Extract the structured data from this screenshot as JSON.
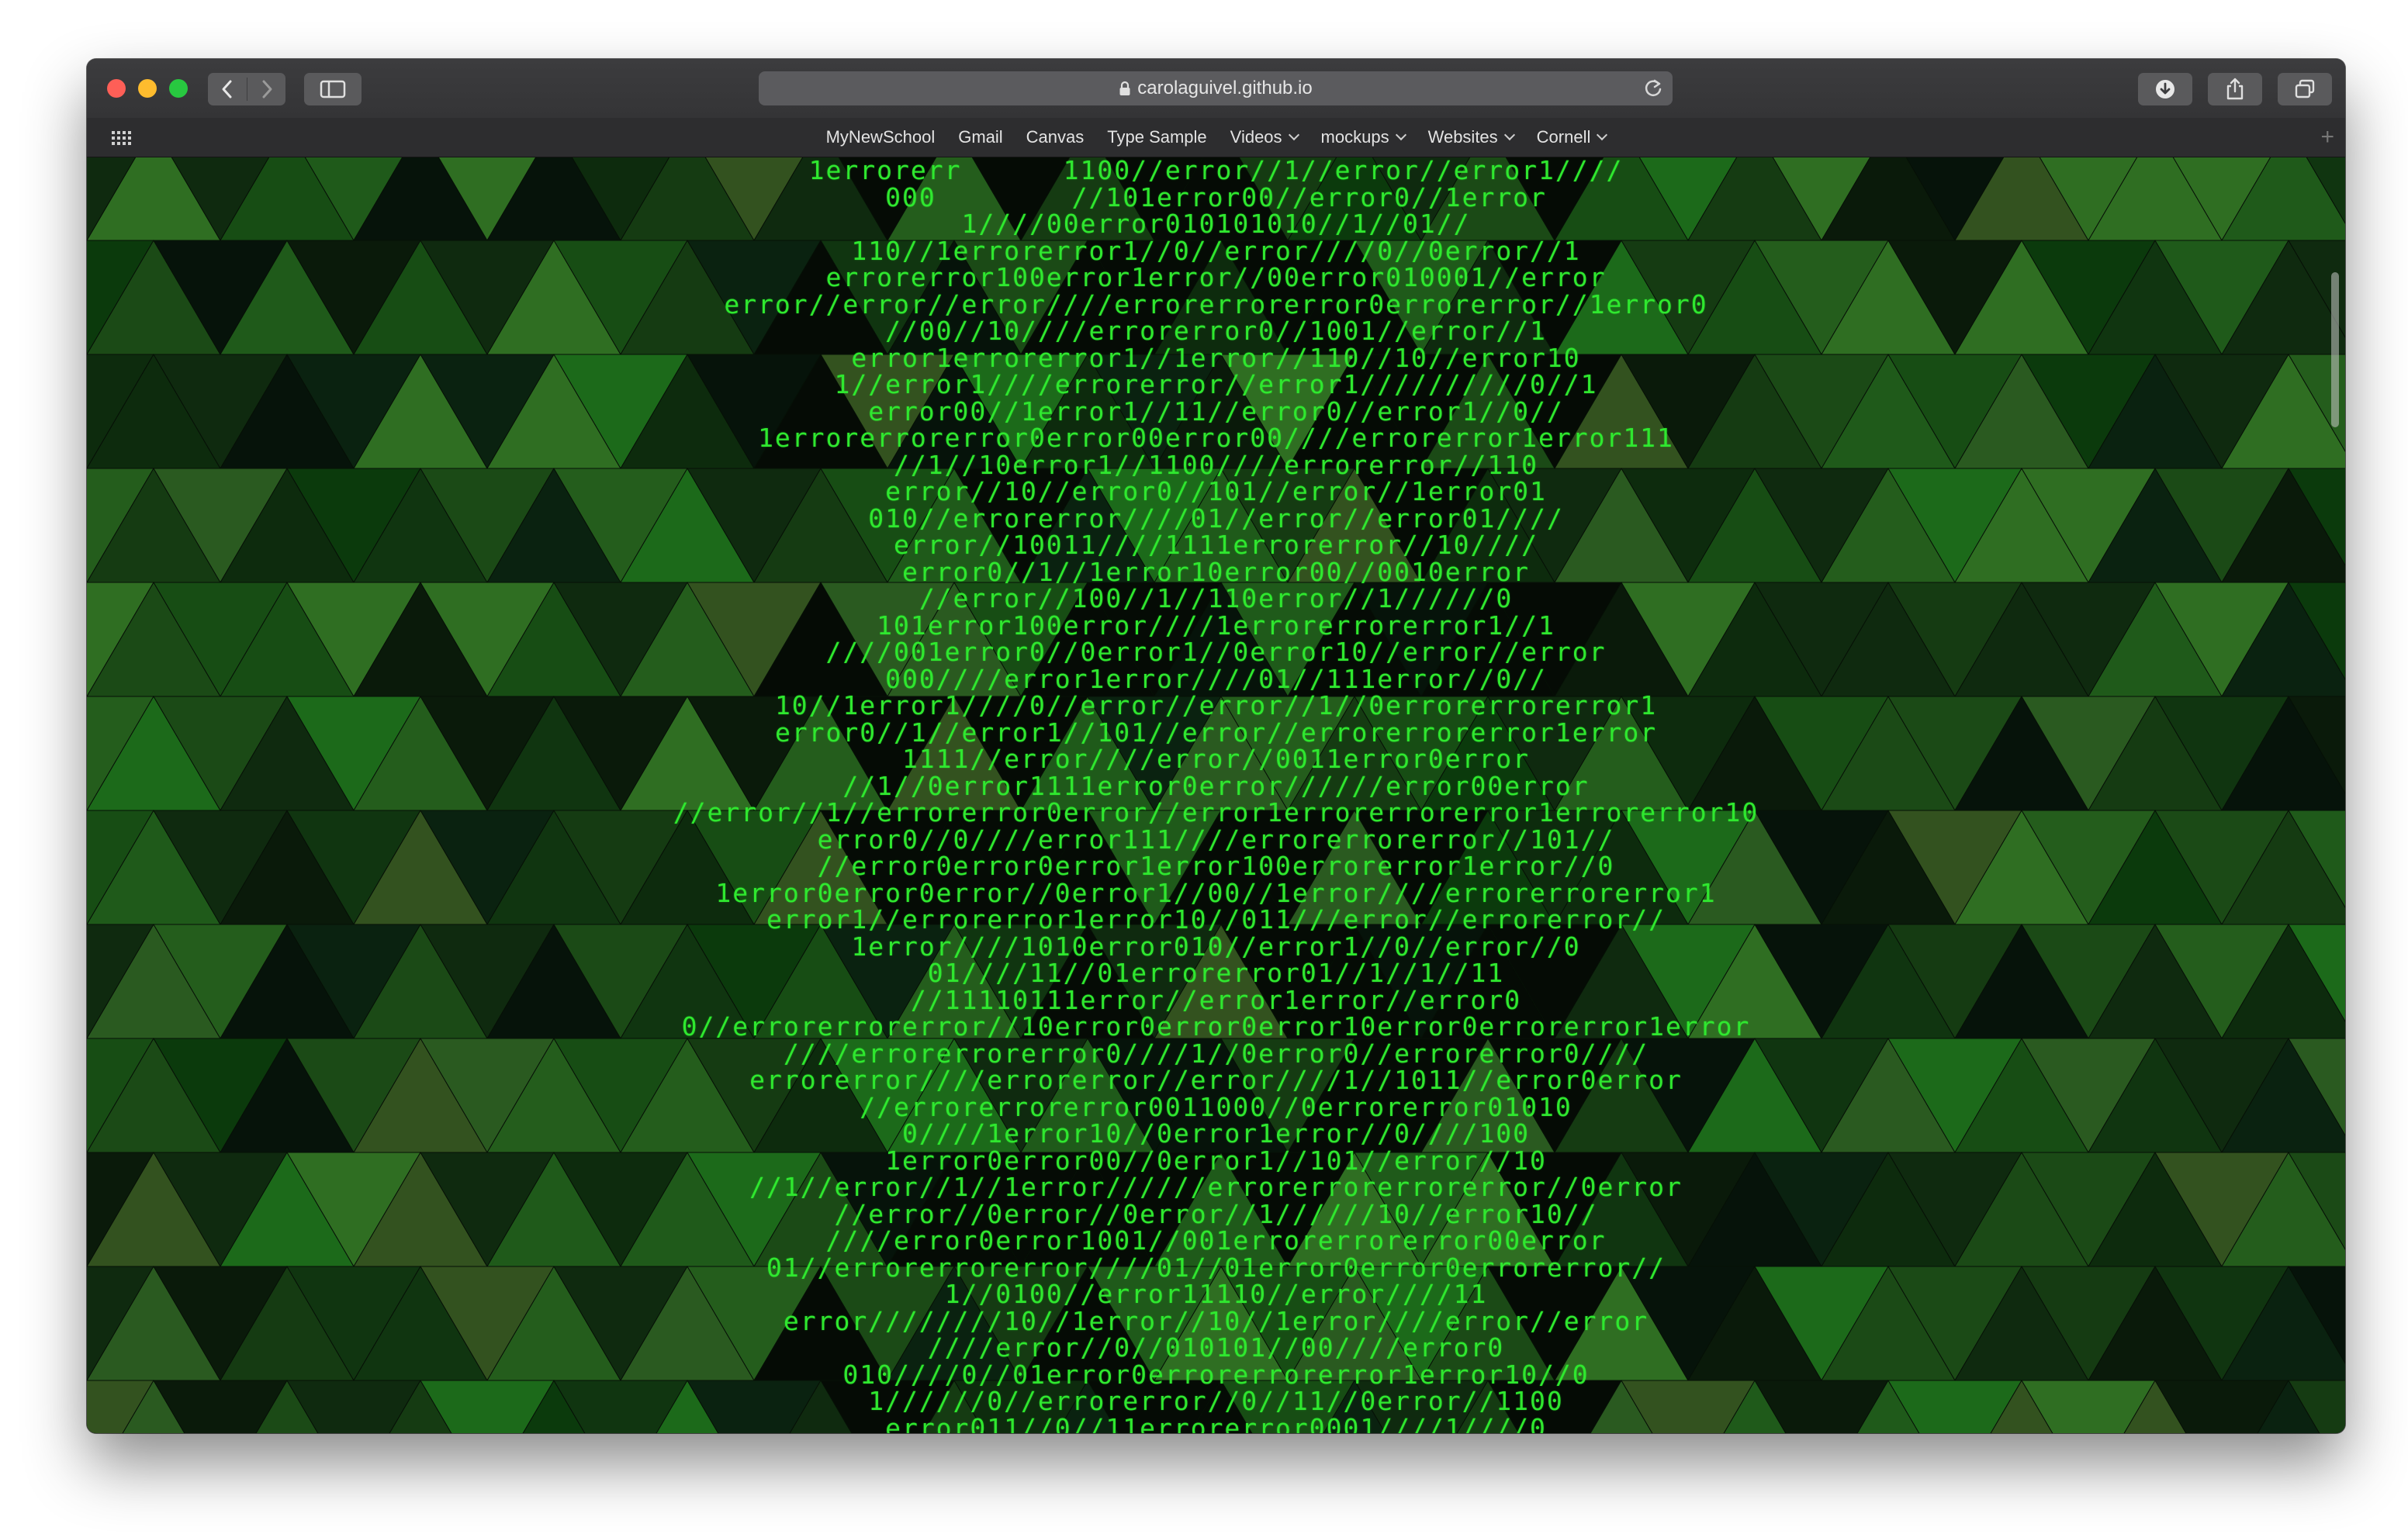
{
  "browser": {
    "url": "carolaguivel.github.io",
    "icons": {
      "back": "chevron-left-icon",
      "forward": "chevron-right-icon",
      "sidebar": "sidebar-icon",
      "lock": "lock-icon",
      "reload": "reload-icon",
      "download": "download-icon",
      "share": "share-icon",
      "tabs": "tabs-overview-icon",
      "favorites": "grid-icon",
      "add_bookmark": "plus-icon"
    },
    "bookmarks": [
      {
        "label": "MyNewSchool",
        "dropdown": false
      },
      {
        "label": "Gmail",
        "dropdown": false
      },
      {
        "label": "Canvas",
        "dropdown": false
      },
      {
        "label": "Type Sample",
        "dropdown": false
      },
      {
        "label": "Videos",
        "dropdown": true
      },
      {
        "label": "mockups",
        "dropdown": true
      },
      {
        "label": "Websites",
        "dropdown": true
      },
      {
        "label": "Cornell",
        "dropdown": true
      }
    ]
  },
  "page": {
    "code_text": "1errorerr      1100//error//1//error//error1////\n000        //101error00//error0//1error\n1////00error010101010//1//01//\n110//1errorerror1//0//error////0//0error//1\nerrorerror100error1error//00error010001//error\nerror//error//error////errorerrorerror0errorerror//1error0\n//00//10////errorerror0//1001//error//1\nerror1errorerror1//1error//110//10//error10\n1//error1////errorerror//error1//////////0//1\nerror00//1error1//11//error0//error1//0//\n1errorerrorerror0error00error00////errorerror1error111\n//1//10error1//1100////errorerror//110\nerror//10//error0//101//error//1error01\n010//errorerror////01//error//error01////\nerror//10011////1111errorerror//10////\nerror0//1//1error10error00//0010error\n//error//100//1//110error//1//////0\n101error100error////1errorerrorerror1//1\n////001error0//0error1//0error10//error//error\n000////error1error////01//111error//0//\n10//1error1////0//error//error//1//0errorerrorerror1\nerror0//1//error1//101//error//errorerrorerror1error\n1111//error////error//0011error0error\n//1//0error1111error0error//////error00error\n//error//1//errorerror0error//error1errorerrorerror1errorerror10\nerror0//0////error111////errorerrorerror//101//\n//error0error0error1error100errorerror1error//0\n1error0error0error//0error1//00//1error////errorerrorerror1\nerror1//errorerror1error10//011///error//errorerror//\n1error////1010error010//error1//0//error//0\n01////11//01errorerror01//1//1//11\n//11110111error//error1error//error0\n0//errorerrorerror//10error0error0error10error0errorerror1error\n////errorerrorerror0////1//0error0//errorerror0////\nerrorerror////errorerror//error////1//1011//error0error\n//errorerrorerror0011000//0errorerror01010\n0////1error10//0error1error//0////100\n1error0error00//0error1//101//error//10\n//1//error//1//1error//////errorerrorerrorerror//0error\n//error//0error//0error//1//////10//error10//\n////error0error1001//001errorerrorerror00error\n01//errorerrorerror////01//01error0error0errorerror//\n1//0100//error11110//error////11\nerror////////10//1error//10//1error////error//error\n////error//0//010101//00////error0\n010////0//01error0errorerrorerror1error10//0\n1//////0//errorerror//0//11//0error//1100\nerror011//0//11errorerror0001////1////0"
  }
}
